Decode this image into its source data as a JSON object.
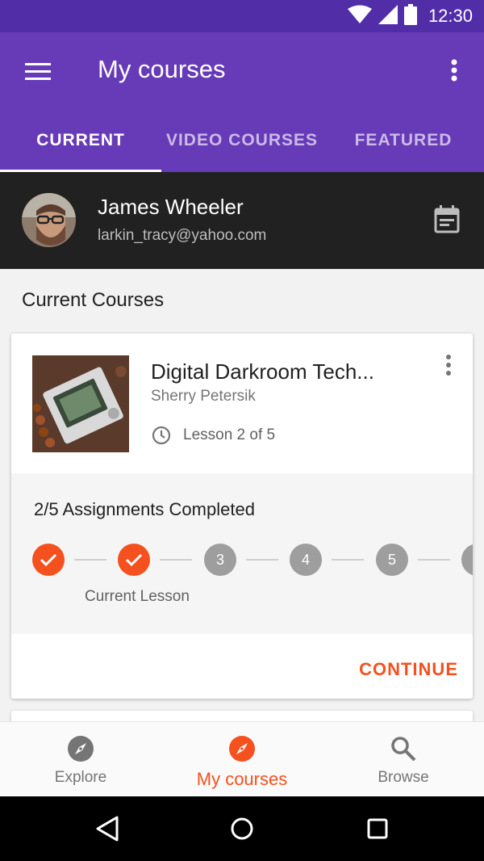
{
  "status_bar": {
    "time": "12:30",
    "icons": [
      "wifi-icon",
      "signal-icon",
      "battery-icon"
    ]
  },
  "app_bar": {
    "title": "My courses",
    "icons": [
      "menu-icon",
      "more-vert-icon"
    ]
  },
  "tabs": [
    {
      "label": "CURRENT",
      "active": true
    },
    {
      "label": "VIDEO COURSES",
      "active": false
    },
    {
      "label": "FEATURED",
      "active": false
    }
  ],
  "profile": {
    "name": "James Wheeler",
    "email": "larkin_tracy@yahoo.com",
    "icon": "calendar-icon"
  },
  "section_title": "Current Courses",
  "course": {
    "title": "Digital Darkroom Tech...",
    "author": "Sherry Petersik",
    "lesson": "Lesson 2 of 5",
    "assignments": "2/5 Assignments Completed",
    "steps": [
      {
        "label": "",
        "done": true
      },
      {
        "label": "",
        "done": true
      },
      {
        "label": "3",
        "done": false
      },
      {
        "label": "4",
        "done": false
      },
      {
        "label": "5",
        "done": false
      },
      {
        "label": "",
        "done": false
      }
    ],
    "current_lesson_label": "Current Lesson",
    "continue_label": "CONTINUE"
  },
  "bottom_nav": [
    {
      "label": "Explore",
      "icon": "compass-icon",
      "active": false
    },
    {
      "label": "My courses",
      "icon": "compass-icon",
      "active": true
    },
    {
      "label": "Browse",
      "icon": "search-icon",
      "active": false
    }
  ],
  "colors": {
    "primary": "#673ab7",
    "primary_dark": "#512da8",
    "accent": "#f4511e",
    "profile_bg": "#212121"
  }
}
